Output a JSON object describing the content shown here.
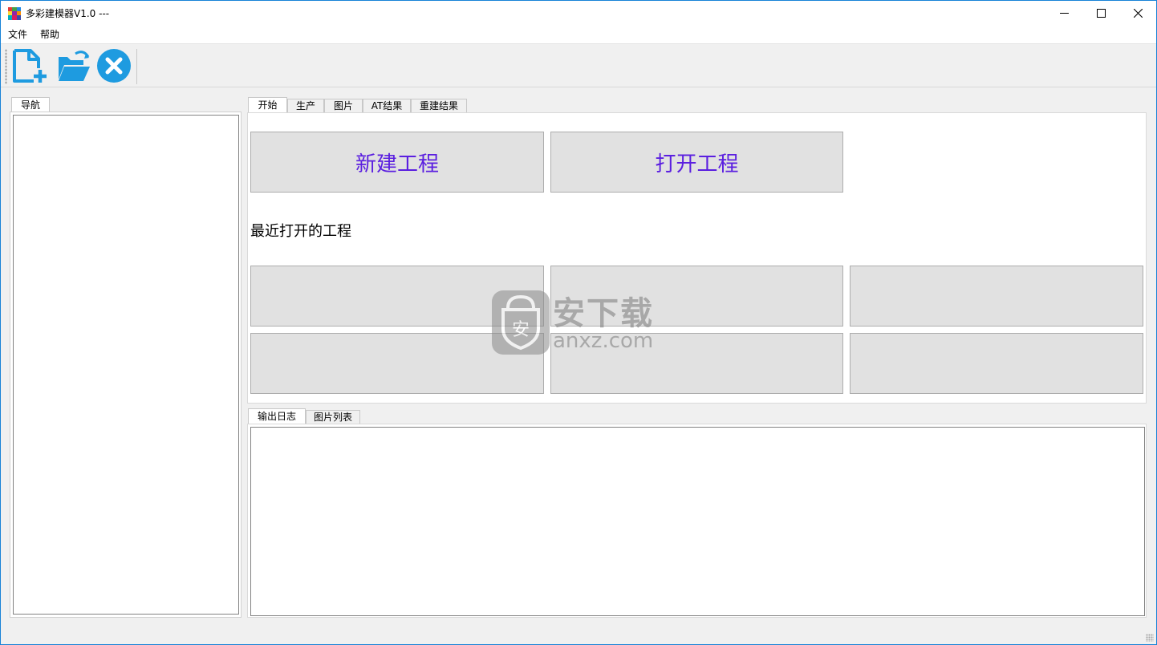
{
  "window": {
    "title": "多彩建模器V1.0  ---",
    "controls": {
      "minimize": "—",
      "maximize": "☐",
      "close": "✕"
    }
  },
  "menu": {
    "items": [
      "文件",
      "帮助"
    ]
  },
  "toolbar": {
    "buttons": [
      {
        "icon": "new-file-icon",
        "color": "#1e9be0"
      },
      {
        "icon": "open-folder-icon",
        "color": "#1e9be0"
      },
      {
        "icon": "close-circle-icon",
        "color": "#1e9be0"
      }
    ]
  },
  "nav": {
    "tab_label": "导航"
  },
  "main": {
    "tabs": [
      "开始",
      "生产",
      "图片",
      "AT结果",
      "重建结果"
    ],
    "active_tab": "开始",
    "new_project_label": "新建工程",
    "open_project_label": "打开工程",
    "recent_label": "最近打开的工程",
    "button_text_color": "#5b1fe0"
  },
  "output": {
    "tabs": [
      "输出日志",
      "图片列表"
    ],
    "active_tab": "输出日志"
  },
  "watermark": {
    "text": "安下载",
    "url_text": "anxz.com"
  }
}
